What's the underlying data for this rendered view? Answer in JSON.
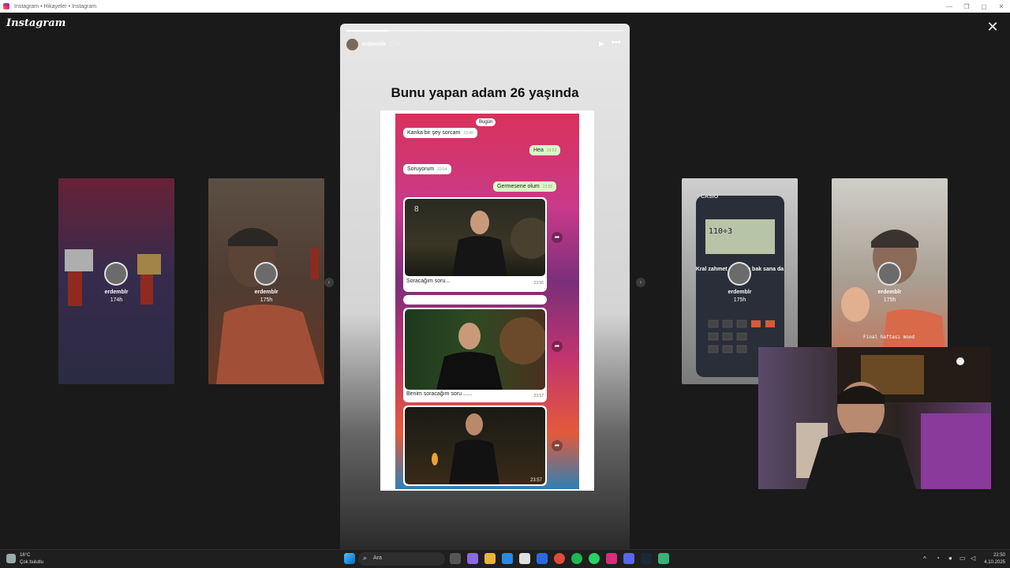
{
  "window": {
    "title": "Instagram • Hikayeler • Instagram"
  },
  "brand": {
    "logo_text": "Instagram"
  },
  "story": {
    "username": "erdemblr",
    "time": "175h",
    "progress": 0.15,
    "headline": "Bunu yapan adam 26 yaşında",
    "chat": {
      "date_label": "Bugün",
      "messages": [
        {
          "text": "Kanka bir şey sorcam",
          "time": "23:49",
          "side": "in"
        },
        {
          "text": "Hea",
          "time": "23:52",
          "side": "out"
        },
        {
          "text": "Soruyorum",
          "time": "23:54",
          "side": "in"
        },
        {
          "text": "Germesene olum",
          "time": "23:55",
          "side": "out"
        }
      ],
      "videos": [
        {
          "caption": "Soracağım soru...",
          "time": "23:56",
          "badge": "8"
        },
        {
          "caption": "Benim soracağım soru ......",
          "time": "23:57",
          "badge": ""
        },
        {
          "caption": "",
          "time": "23:57",
          "badge": ""
        }
      ]
    }
  },
  "side_stories": [
    {
      "username": "erdemblr",
      "time": "174h",
      "overlay_text": "",
      "color": "#b24a6a"
    },
    {
      "username": "erdemblr",
      "time": "175h",
      "overlay_text": "",
      "color": "#8a6a5a"
    },
    {
      "username": "erdemblr",
      "time": "175h",
      "overlay_text": "Kral zahmet olmazsa bak sana da",
      "color": "#6a6a6a"
    },
    {
      "username": "erdemblr",
      "time": "175h",
      "overlay_text": "Final haftası mood",
      "color": "#9a8a7a"
    }
  ],
  "calculator": {
    "brand": "CASIO",
    "display": "110÷3"
  },
  "taskbar": {
    "weather_temp": "16°C",
    "weather_desc": "Çok bulutlu",
    "search_placeholder": "Ara",
    "clock_time": "22:50",
    "clock_date": "4.10.2025"
  }
}
